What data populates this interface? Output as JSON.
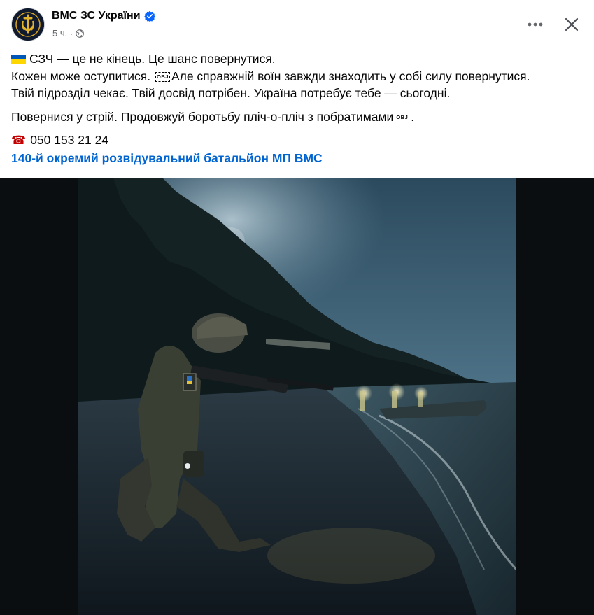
{
  "header": {
    "author": "ВМС ЗС України",
    "time": "5 ч.",
    "separator": "·"
  },
  "post": {
    "line1": "СЗЧ — це не кінець. Це шанс повернутися.",
    "line2a": "Кожен може оступитися.",
    "obj1": "OBJ",
    "line2b": "Але справжній воїн завжди знаходить у собі силу повернутися.",
    "line3": "Твій підрозділ чекає. Твій досвід потрібен. Україна потребує тебе — сьогодні.",
    "line4": "Повернися у стрій. Продовжуй боротьбу пліч-о-пліч з побратимами",
    "obj2": "OBJ",
    "line4_end": ".",
    "phone_icon": "☎",
    "phone": "050 153 21 24",
    "link": "140-й окремий розвідувальний батальйон МП ВМС"
  },
  "icons": {
    "flag": "ukraine-flag-icon",
    "verified": "verified-badge-icon",
    "globe": "globe-icon",
    "more": "more-horizontal-icon",
    "close": "close-icon"
  },
  "colors": {
    "text": "#050505",
    "secondary": "#65676b",
    "link": "#0064d1",
    "verified": "#0866ff"
  }
}
